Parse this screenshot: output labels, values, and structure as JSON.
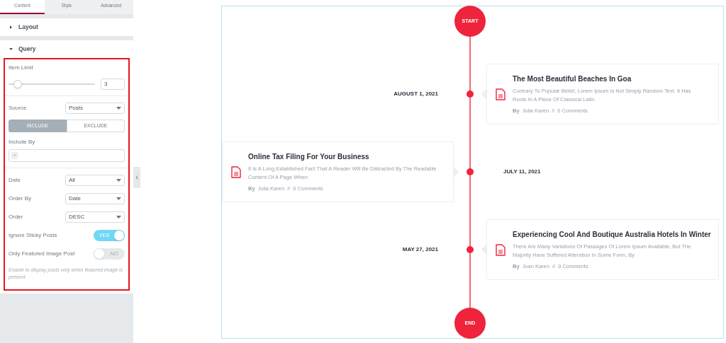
{
  "tabs": [
    {
      "label": "Content",
      "selected": true
    },
    {
      "label": "Style",
      "selected": false
    },
    {
      "label": "Advanced",
      "selected": false
    }
  ],
  "sections": [
    {
      "title": "Layout",
      "expanded": false
    },
    {
      "title": "Query",
      "expanded": true
    }
  ],
  "query": {
    "item_limit": {
      "label": "Item Limit",
      "level": 0.06,
      "value": "3"
    },
    "controls": [
      {
        "kind": "select",
        "label": "Source",
        "value": "Posts"
      },
      {
        "kind": "segmented",
        "options": [
          {
            "label": "INCLUDE",
            "selected": true
          },
          {
            "label": "EXCLUDE",
            "selected": false
          }
        ]
      },
      {
        "kind": "repeater",
        "label": "Include By",
        "add": "+"
      },
      {
        "kind": "select",
        "label": "Date",
        "value": "All"
      },
      {
        "kind": "select",
        "label": "Order By",
        "value": "Date"
      },
      {
        "kind": "select",
        "label": "Order",
        "value": "DESC"
      },
      {
        "kind": "toggle",
        "label": "Ignore Sticky Posts",
        "on": true,
        "text": "YES"
      },
      {
        "kind": "toggle",
        "label": "Only Featured Image Post",
        "on": false,
        "text": "NO"
      },
      {
        "kind": "note",
        "text": "Enable to display posts only when featured image is present."
      }
    ]
  },
  "timeline": {
    "start": "START",
    "end": "END",
    "items": [
      {
        "kind": "right",
        "date": "AUGUST 1, 2021",
        "title": "The Most Beautiful Beaches In Goa",
        "excerpt": "Contrary To Popular Belief, Lorem Ipsum Is Not Simply Random Text. It Has Roots In A Piece Of Classical Latin",
        "by": "By",
        "author": "Julia Karen",
        "sep": "//",
        "comments": "0 Comments"
      },
      {
        "kind": "left",
        "date": "JULY 11, 2021",
        "title": "Online Tax Filing For Your Business",
        "excerpt": "It Is A Long Established Fact That A Reader Will Be Distracted By The Readable Content Of A Page When",
        "by": "By",
        "author": "Julia Karen",
        "sep": "//",
        "comments": "0 Comments"
      },
      {
        "kind": "right",
        "date": "MAY 27, 2021",
        "title": "Experiencing Cool And Boutique Australia Hotels In Winter",
        "excerpt": "There Are Many Variations Of Passages Of Lorem Ipsum Available, But The Majority Have Suffered Alteration In Some Form, By",
        "by": "By",
        "author": "Joan Karen",
        "sep": "//",
        "comments": "0 Comments"
      }
    ]
  }
}
